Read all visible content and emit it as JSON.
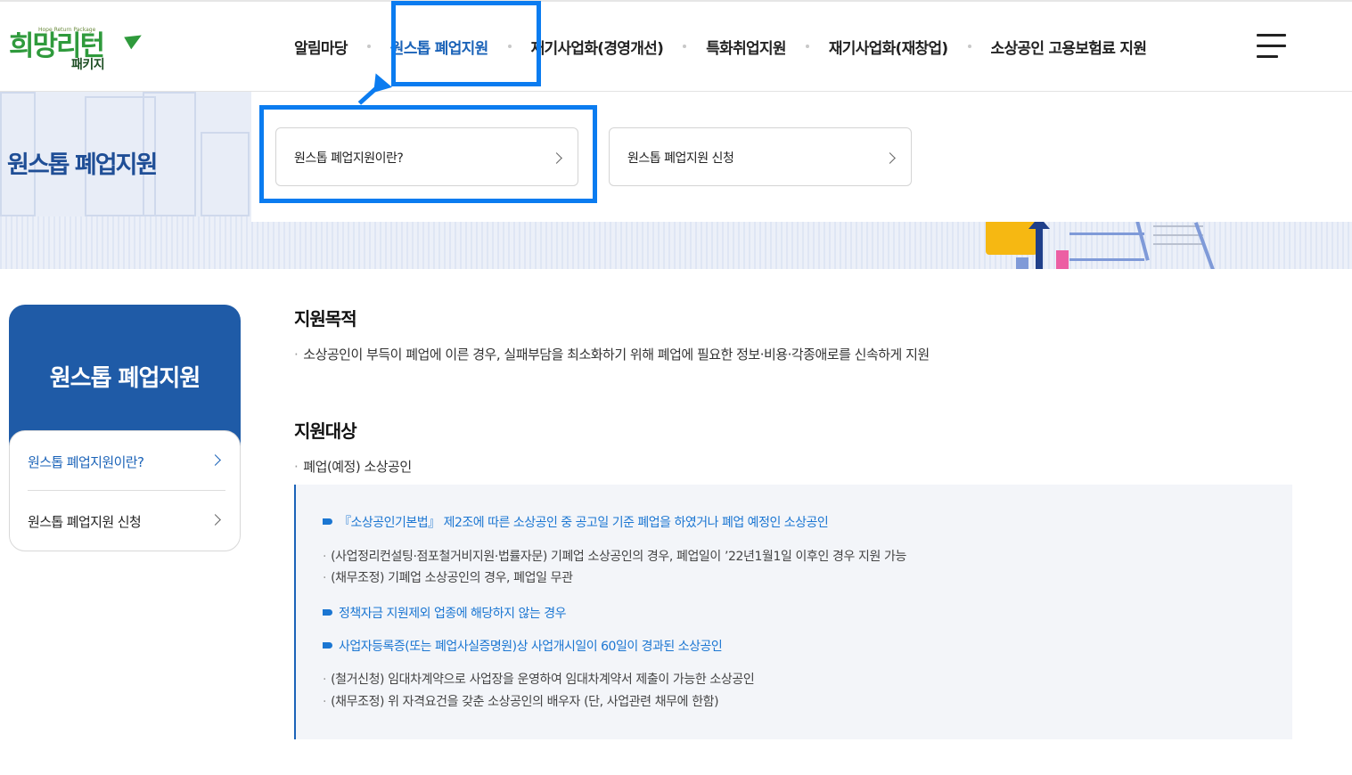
{
  "logo": {
    "main": "희망리턴",
    "eng": "Hope Return Package",
    "sub": "패키지"
  },
  "gnb": {
    "items": [
      {
        "label": "알림마당"
      },
      {
        "label": "원스톱 폐업지원"
      },
      {
        "label": "재기사업화(경영개선)"
      },
      {
        "label": "특화취업지원"
      },
      {
        "label": "재기사업화(재창업)"
      },
      {
        "label": "소상공인 고용보험료 지원"
      }
    ],
    "active_index": 1,
    "menu_icon": "hamburger-icon"
  },
  "visual": {
    "title": "원스톱 폐업지원"
  },
  "dropdown": {
    "items": [
      {
        "label": "원스톱 폐업지원이란?"
      },
      {
        "label": "원스톱 폐업지원 신청"
      }
    ]
  },
  "lnb": {
    "title": "원스톱 폐업지원",
    "items": [
      {
        "label": "원스톱 폐업지원이란?"
      },
      {
        "label": "원스톱 폐업지원 신청"
      }
    ]
  },
  "content": {
    "purpose_title": "지원목적",
    "purpose_text": "소상공인이 부득이 폐업에 이른 경우, 실패부담을 최소화하기 위해 폐업에 필요한 정보·비용·각종애로를 신속하게 지원",
    "target_title": "지원대상",
    "target_text": "폐업(예정) 소상공인",
    "box": {
      "b1": "『소상공인기본법』 제2조에 따른 소상공인 중 공고일 기준 폐업을 하였거나 폐업 예정인 소상공인",
      "g1": "(사업정리컨설팅·점포철거비지원·법률자문) 기폐업 소상공인의 경우, 폐업일이 ’22년1월1일 이후인 경우 지원 가능",
      "g2": "(채무조정) 기폐업 소상공인의 경우, 폐업일 무관",
      "b2": "정책자금 지원제외 업종에 해당하지 않는 경우",
      "b3": "사업자등록증(또는 폐업사실증명원)상 사업개시일이 60일이 경과된 소상공인",
      "g3": "(철거신청) 임대차계약으로 사업장을 운영하여 임대차계약서 제출이 가능한 소상공인",
      "g4": "(채무조정) 위 자격요건을 갖춘 소상공인의 배우자 (단, 사업관련 채무에 한함)"
    }
  },
  "colors": {
    "accent_blue": "#1b63b8",
    "highlight_blue": "#0b7cf0",
    "lnb_bg": "#1f5ba7",
    "logo_green": "#2f9a3c"
  }
}
